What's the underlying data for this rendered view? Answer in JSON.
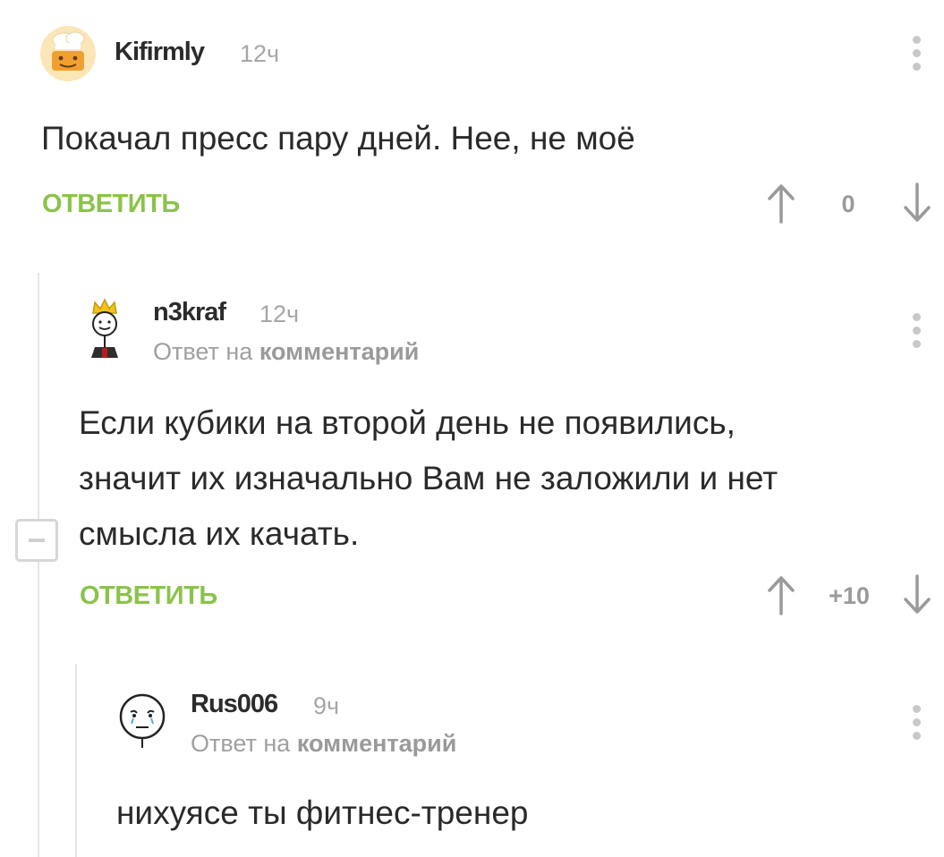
{
  "comments": [
    {
      "username": "Kifirmly",
      "time": "12ч",
      "text_lines": [
        "Покачал пресс пару дней. Нее, не моё"
      ],
      "reply_label": "ОТВЕТИТЬ",
      "score": "0",
      "avatar_icon": "chef-hat-smiley-icon"
    },
    {
      "username": "n3kraf",
      "time": "12ч",
      "reply_prefix": "Ответ на",
      "reply_target": "комментарий",
      "text_lines": [
        "Если кубики на второй день не появились,",
        "значит их изначально Вам не заложили и нет",
        "смысла их качать."
      ],
      "reply_label": "ОТВЕТИТЬ",
      "score": "+10",
      "avatar_icon": "crowned-stickman-icon"
    },
    {
      "username": "Rus006",
      "time": "9ч",
      "reply_prefix": "Ответ на",
      "reply_target": "комментарий",
      "text_lines": [
        "нихуясе ты фитнес-тренер"
      ],
      "avatar_icon": "crying-face-icon"
    }
  ],
  "colors": {
    "accent": "#8bc34a",
    "muted": "#a6a6a6",
    "thread_line": "#e6e6e6"
  }
}
